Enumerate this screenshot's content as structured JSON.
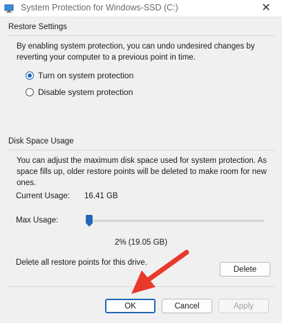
{
  "window": {
    "title": "System Protection for Windows-SSD (C:)",
    "close_glyph": "✕"
  },
  "restore_settings": {
    "heading": "Restore Settings",
    "description": "By enabling system protection, you can undo undesired changes by reverting your computer to a previous point in time.",
    "options": [
      {
        "label": "Turn on system protection",
        "checked": true
      },
      {
        "label": "Disable system protection",
        "checked": false
      }
    ]
  },
  "disk_space": {
    "heading": "Disk Space Usage",
    "description": "You can adjust the maximum disk space used for system protection. As space fills up, older restore points will be deleted to make room for new ones.",
    "current_usage_label": "Current Usage:",
    "current_usage_value": "16.41 GB",
    "max_usage_label": "Max Usage:",
    "max_usage_fraction": 0.02,
    "max_usage_value": "2% (19.05 GB)",
    "delete_text": "Delete all restore points for this drive.",
    "delete_button": "Delete"
  },
  "footer": {
    "ok": "OK",
    "cancel": "Cancel",
    "apply": "Apply"
  },
  "colors": {
    "accent": "#1f67b8",
    "annotation_arrow": "#e8392b"
  },
  "icons": {
    "app": "shield-computer-icon",
    "close": "close-icon",
    "annotation": "red-arrow-pointer"
  }
}
